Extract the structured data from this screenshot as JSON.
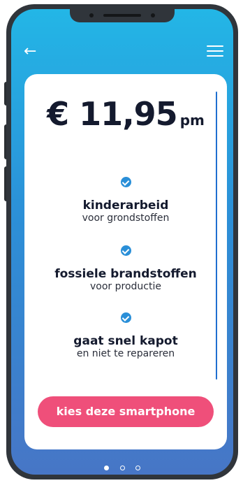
{
  "nav": {
    "back_glyph": "←",
    "menu_icon": "hamburger-icon"
  },
  "offer": {
    "price": "€ 11,95",
    "period": "pm"
  },
  "features": [
    {
      "title": "kinderarbeid",
      "subtitle": "voor grondstoffen"
    },
    {
      "title": "fossiele brandstoffen",
      "subtitle": "voor productie"
    },
    {
      "title": "gaat snel kapot",
      "subtitle": "en niet te repareren"
    }
  ],
  "cta": {
    "label": "kies deze smartphone"
  },
  "pager": {
    "total": 3,
    "active_index": 0
  },
  "colors": {
    "gradient_top": "#23b6e6",
    "gradient_bottom": "#4776c6",
    "cta": "#ef4f7a",
    "check": "#2a8fd8",
    "text_dark": "#141a2e"
  }
}
